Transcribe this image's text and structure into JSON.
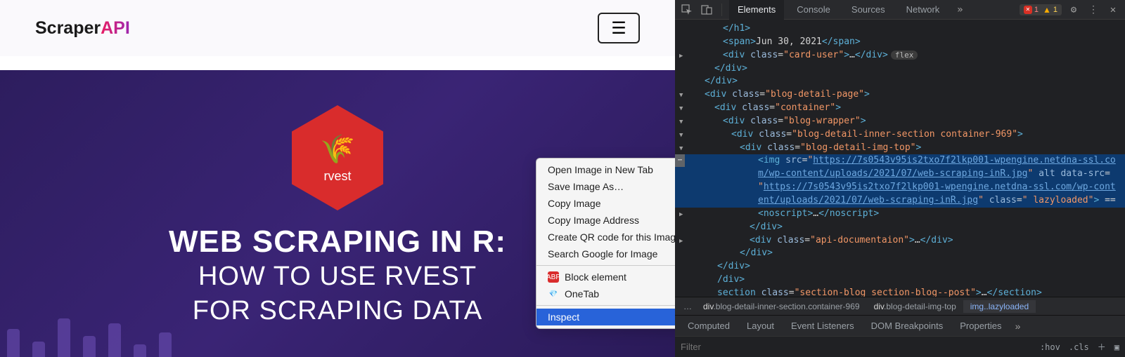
{
  "logo": {
    "part1": "Scraper",
    "part2": "API"
  },
  "hero": {
    "hex_label": "rvest",
    "title": "WEB SCRAPING IN R:",
    "sub1": "HOW TO USE RVEST",
    "sub2": "FOR SCRAPING DATA"
  },
  "context_menu": {
    "items": [
      {
        "label": "Open Image in New Tab"
      },
      {
        "label": "Save Image As…"
      },
      {
        "label": "Copy Image"
      },
      {
        "label": "Copy Image Address"
      },
      {
        "label": "Create QR code for this Image"
      },
      {
        "label": "Search Google for Image"
      }
    ],
    "block": "Block element",
    "onetab": "OneTab",
    "inspect": "Inspect"
  },
  "devtools": {
    "tabs": [
      "Elements",
      "Console",
      "Sources",
      "Network"
    ],
    "err_count": "1",
    "warn_count": "1",
    "date_text": "Jun 30, 2021",
    "flex_pill": "flex",
    "breadcrumbs": [
      {
        "el": "div",
        "cls": ".blog-detail-inner-section.container-969"
      },
      {
        "el": "div",
        "cls": ".blog-detail-img-top"
      },
      {
        "el": "img",
        "cls": "..lazyloaded"
      }
    ],
    "subtabs": [
      "Computed",
      "Layout",
      "Event Listeners",
      "DOM Breakpoints",
      "Properties"
    ],
    "filter_placeholder": "Filter",
    "hov": ":hov",
    "cls": ".cls",
    "html": {
      "h1_close": "</h1>",
      "span_open": "<span>",
      "span_close": "</span>",
      "div_carduser": "card-user",
      "div_close": "</div>",
      "blog_detail_page": "blog-detail-page",
      "container": "container",
      "blog_wrapper": "blog-wrapper",
      "inner_section": "blog-detail-inner-section container-969",
      "img_top": "blog-detail-img-top",
      "img_src": "https://7s0543v95is2txo7f2lkp001-wpengine.netdna-ssl.co",
      "img_src2": "m/wp-content/uploads/2021/07/web-scraping-inR.jpg",
      "img_datasrc": "https://7s0543v95is2txo7f2lkp001-wpengine.netdna-ssl.com/wp-cont",
      "img_datasrc2": "ent/uploads/2021/07/web-scraping-inR.jpg",
      "lazyloaded": " lazyloaded",
      "noscript": "<noscript>",
      "noscript_close": "</noscript>",
      "api_doc": "api-documentaion",
      "section_cls": "section-blog section-blog--post",
      "section_open": "section",
      "section_close": "</section>",
      "ection_close": "ection>"
    }
  }
}
